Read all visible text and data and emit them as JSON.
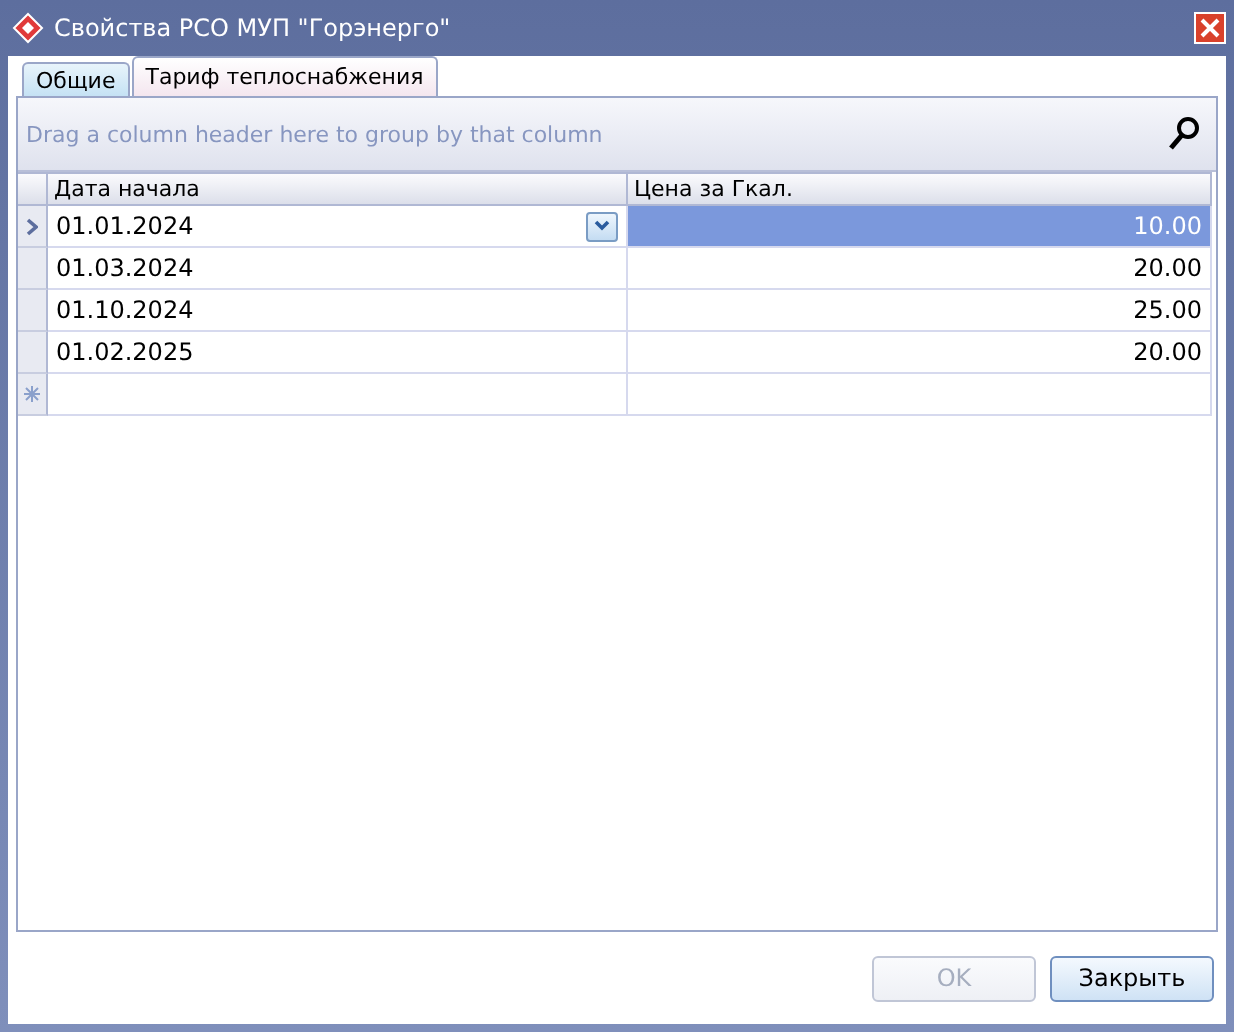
{
  "window": {
    "title": "Свойства РСО МУП \"Горэнерго\""
  },
  "tabs": [
    {
      "label": "Общие",
      "selected": false
    },
    {
      "label": "Тариф теплоснабжения",
      "selected": true
    }
  ],
  "grid": {
    "group_hint": "Drag a column header here to group by that column",
    "columns": [
      "Дата начала",
      "Цена за Гкал."
    ],
    "rows": [
      {
        "date": "01.01.2024",
        "price": "10.00",
        "selected": true
      },
      {
        "date": "01.03.2024",
        "price": "20.00",
        "selected": false
      },
      {
        "date": "01.10.2024",
        "price": "25.00",
        "selected": false
      },
      {
        "date": "01.02.2025",
        "price": "20.00",
        "selected": false
      }
    ]
  },
  "buttons": [
    {
      "label": "OK",
      "disabled": true
    },
    {
      "label": "Закрыть",
      "disabled": false
    }
  ]
}
